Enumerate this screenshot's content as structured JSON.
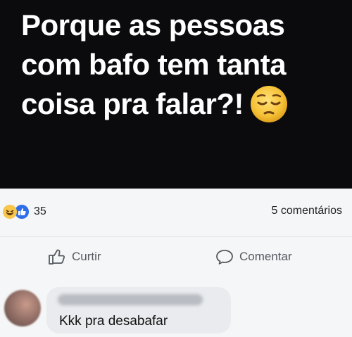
{
  "post": {
    "text_lines": [
      "Porque as  pessoas",
      "com bafo tem tanta",
      "coisa pra falar?!"
    ],
    "emoji": "pensive-face-icon"
  },
  "stats": {
    "reactions": [
      "haha",
      "like"
    ],
    "reaction_count": "35",
    "comments": "5 comentários"
  },
  "actions": {
    "like_label": "Curtir",
    "comment_label": "Comentar"
  },
  "comment": {
    "text": "Kkk  pra desabafar"
  },
  "colors": {
    "post_bg": "#0b0b0d",
    "like_blue": "#2f6fe8",
    "haha_yellow": "#f7c64a"
  }
}
